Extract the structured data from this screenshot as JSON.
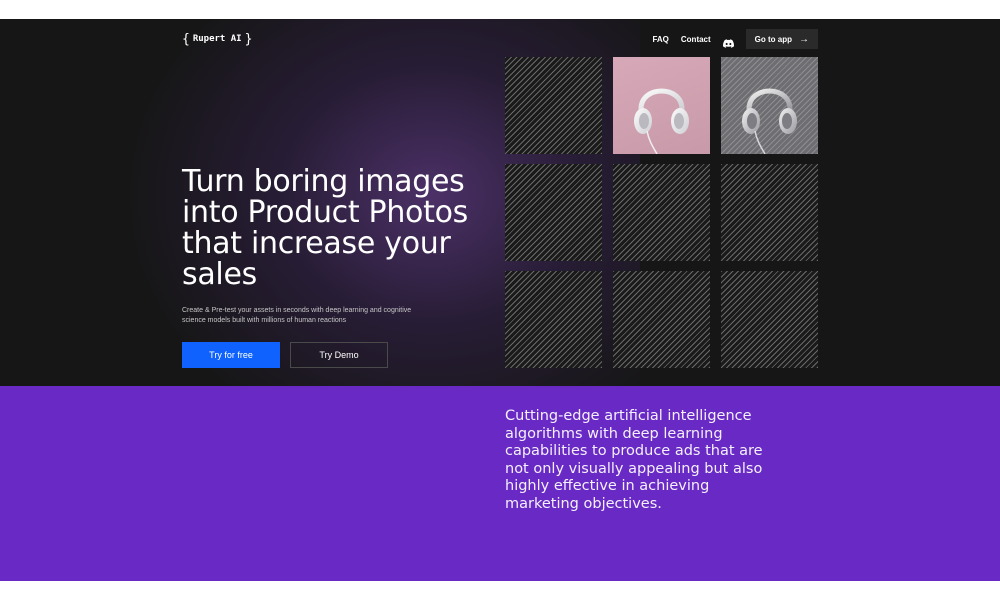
{
  "nav": {
    "logo_open": "{",
    "logo_text": "Rupert AI",
    "logo_close": "}",
    "links": [
      {
        "label": "FAQ"
      },
      {
        "label": "Contact"
      }
    ],
    "discord_icon": "discord-icon",
    "go_to_app_label": "Go to app",
    "go_to_app_icon": "arrow-right-icon"
  },
  "hero": {
    "headline": "Turn boring images into Product Photos that increase your sales",
    "subtext": "Create & Pre-test your assets in seconds with deep learning and cognitive science models built with millions of human reactions",
    "primary_cta": "Try for free",
    "secondary_cta": "Try Demo",
    "colors": {
      "background": "#161616",
      "glow": "#7846aa",
      "primary_button": "#0f62fe"
    }
  },
  "gallery": {
    "tiles": [
      {
        "kind": "hatched"
      },
      {
        "kind": "headphones-photo",
        "background": "#d7a9b8"
      },
      {
        "kind": "headphones-photo-gray",
        "background": "#6e6e72"
      },
      {
        "kind": "hatched"
      },
      {
        "kind": "hatched"
      },
      {
        "kind": "hatched"
      },
      {
        "kind": "hatched"
      },
      {
        "kind": "hatched"
      },
      {
        "kind": "hatched"
      }
    ]
  },
  "band": {
    "text": "Cutting-edge artificial intelligence algorithms with deep learning capabilities to produce ads that are not only visually appealing but also highly effective in achieving marketing objectives.",
    "color": "#6929c4"
  }
}
